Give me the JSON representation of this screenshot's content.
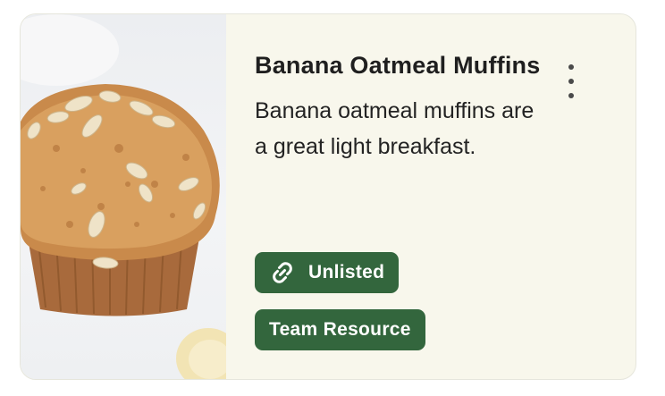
{
  "card": {
    "title": "Banana Oatmeal Muffins",
    "description": "Banana oatmeal muffins are a great light breakfast.",
    "image_icon": "banana-oatmeal-muffin-photo",
    "chips": {
      "unlisted": {
        "label": "Unlisted",
        "icon": "link-icon"
      },
      "team": {
        "label": "Team Resource"
      }
    },
    "menu_icon": "more-vert-icon"
  },
  "colors": {
    "card_background": "#f8f7ec",
    "chip_background": "#33663d",
    "chip_text": "#ffffff",
    "title_text": "#1f1f1f"
  }
}
